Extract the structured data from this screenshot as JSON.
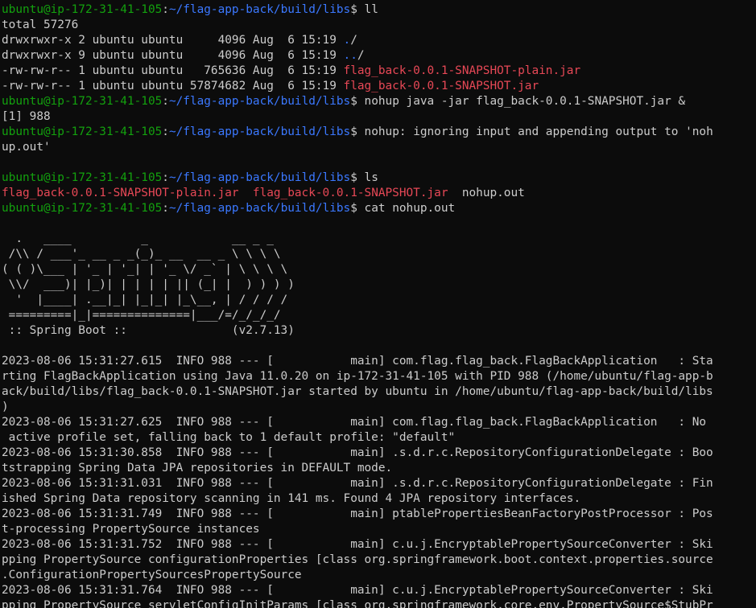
{
  "theme": {
    "background": "#0c0c0c",
    "text": "#cccccc",
    "user_host": "#13a10e",
    "path": "#3b78ff",
    "jar_file": "#e74856"
  },
  "prompt": {
    "user_host": "ubuntu@ip-172-31-41-105",
    "sep": ":",
    "path": "~/flag-app-back/build/libs",
    "symbol": "$ "
  },
  "terminal": {
    "cmd_ll": "ll",
    "total": "total 57276",
    "listing": [
      {
        "meta": "drwxrwxr-x 2 ubuntu ubuntu     4096 Aug  6 15:19 ",
        "name": ".",
        "suffix": "/"
      },
      {
        "meta": "drwxrwxr-x 9 ubuntu ubuntu     4096 Aug  6 15:19 ",
        "name": "..",
        "suffix": "/"
      },
      {
        "meta": "-rw-rw-r-- 1 ubuntu ubuntu   765636 Aug  6 15:19 ",
        "name": "flag_back-0.0.1-SNAPSHOT-plain.jar",
        "suffix": ""
      },
      {
        "meta": "-rw-rw-r-- 1 ubuntu ubuntu 57874682 Aug  6 15:19 ",
        "name": "flag_back-0.0.1-SNAPSHOT.jar",
        "suffix": ""
      }
    ],
    "cmd_nohup": "nohup java -jar flag_back-0.0.1-SNAPSHOT.jar &",
    "job": "[1] 988",
    "nohup_msg_1": "nohup: ignoring input and appending output to 'noh",
    "nohup_msg_2": "up.out'",
    "cmd_ls": "ls",
    "ls_out": {
      "file1": "flag_back-0.0.1-SNAPSHOT-plain.jar",
      "gap1": "  ",
      "file2": "flag_back-0.0.1-SNAPSHOT.jar",
      "gap2": "  ",
      "file3": "nohup.out"
    },
    "cmd_cat": "cat nohup.out",
    "banner": [
      "  .   ____          _            __ _ _",
      " /\\\\ / ___'_ __ _ _(_)_ __  __ _ \\ \\ \\ \\",
      "( ( )\\___ | '_ | '_| | '_ \\/ _` | \\ \\ \\ \\",
      " \\\\/  ___)| |_)| | | | | || (_| |  ) ) ) )",
      "  '  |____| .__|_| |_|_| |_\\__, | / / / /",
      " =========|_|==============|___/=/_/_/_/",
      " :: Spring Boot ::               (v2.7.13)"
    ],
    "log": [
      "2023-08-06 15:31:27.615  INFO 988 --- [           main] com.flag.flag_back.FlagBackApplication   : Sta",
      "rting FlagBackApplication using Java 11.0.20 on ip-172-31-41-105 with PID 988 (/home/ubuntu/flag-app-b",
      "ack/build/libs/flag_back-0.0.1-SNAPSHOT.jar started by ubuntu in /home/ubuntu/flag-app-back/build/libs",
      ")",
      "2023-08-06 15:31:27.625  INFO 988 --- [           main] com.flag.flag_back.FlagBackApplication   : No",
      " active profile set, falling back to 1 default profile: \"default\"",
      "2023-08-06 15:31:30.858  INFO 988 --- [           main] .s.d.r.c.RepositoryConfigurationDelegate : Boo",
      "tstrapping Spring Data JPA repositories in DEFAULT mode.",
      "2023-08-06 15:31:31.031  INFO 988 --- [           main] .s.d.r.c.RepositoryConfigurationDelegate : Fin",
      "ished Spring Data repository scanning in 141 ms. Found 4 JPA repository interfaces.",
      "2023-08-06 15:31:31.749  INFO 988 --- [           main] ptablePropertiesBeanFactoryPostProcessor : Pos",
      "t-processing PropertySource instances",
      "2023-08-06 15:31:31.752  INFO 988 --- [           main] c.u.j.EncryptablePropertySourceConverter : Ski",
      "pping PropertySource configurationProperties [class org.springframework.boot.context.properties.source",
      ".ConfigurationPropertySourcesPropertySource",
      "2023-08-06 15:31:31.764  INFO 988 --- [           main] c.u.j.EncryptablePropertySourceConverter : Ski",
      "pping PropertySource servletConfigInitParams [class org.springframework.core.env.PropertySource$StubPr"
    ]
  }
}
